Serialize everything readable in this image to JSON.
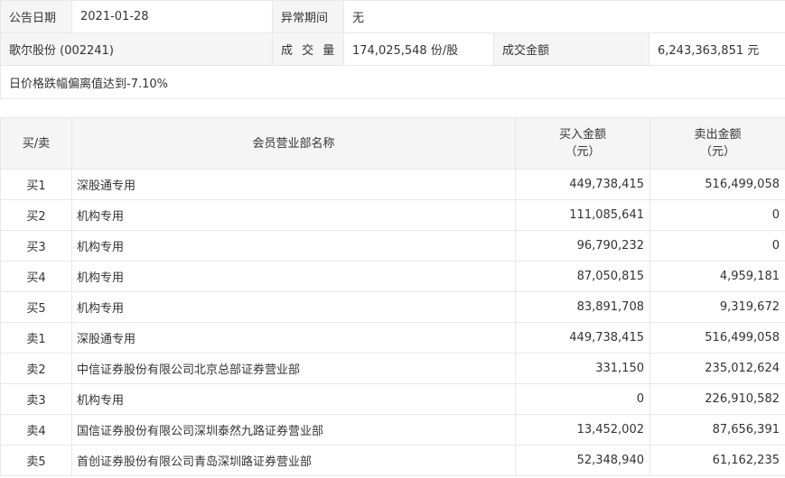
{
  "info": {
    "announce_date_label": "公告日期",
    "announce_date": "2021-01-28",
    "abnormal_period_label": "异常期间",
    "abnormal_period": "无",
    "stock_name": "歌尔股份 (002241)",
    "volume_label": "成 交 量",
    "volume": "174,025,548 份/股",
    "turnover_label": "成交金额",
    "turnover": "6,243,363,851 元",
    "reason": "日价格跌幅偏离值达到-7.10%"
  },
  "trades": {
    "headers": {
      "side": "买/卖",
      "branch": "会员营业部名称",
      "buy_line1": "买入金额",
      "buy_line2": "（元）",
      "sell_line1": "卖出金额",
      "sell_line2": "（元）"
    },
    "rows": [
      {
        "side": "买1",
        "branch": "深股通专用",
        "buy": "449,738,415",
        "sell": "516,499,058"
      },
      {
        "side": "买2",
        "branch": "机构专用",
        "buy": "111,085,641",
        "sell": "0"
      },
      {
        "side": "买3",
        "branch": "机构专用",
        "buy": "96,790,232",
        "sell": "0"
      },
      {
        "side": "买4",
        "branch": "机构专用",
        "buy": "87,050,815",
        "sell": "4,959,181"
      },
      {
        "side": "买5",
        "branch": "机构专用",
        "buy": "83,891,708",
        "sell": "9,319,672"
      },
      {
        "side": "卖1",
        "branch": "深股通专用",
        "buy": "449,738,415",
        "sell": "516,499,058"
      },
      {
        "side": "卖2",
        "branch": "中信证券股份有限公司北京总部证券营业部",
        "buy": "331,150",
        "sell": "235,012,624"
      },
      {
        "side": "卖3",
        "branch": "机构专用",
        "buy": "0",
        "sell": "226,910,582"
      },
      {
        "side": "卖4",
        "branch": "国信证券股份有限公司深圳泰然九路证券营业部",
        "buy": "13,452,002",
        "sell": "87,656,391"
      },
      {
        "side": "卖5",
        "branch": "首创证券股份有限公司青岛深圳路证券营业部",
        "buy": "52,348,940",
        "sell": "61,162,235"
      }
    ]
  }
}
